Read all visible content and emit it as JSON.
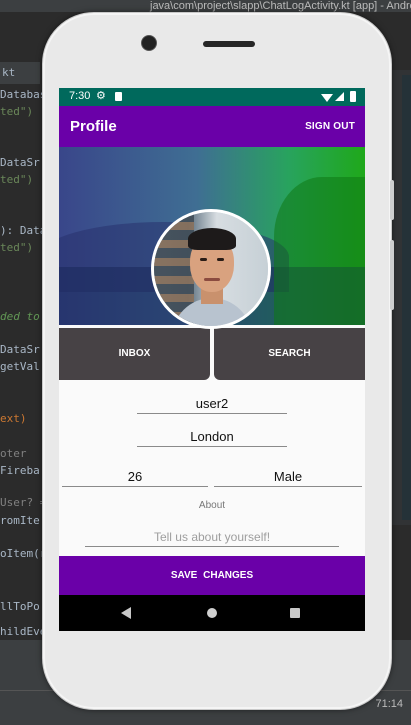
{
  "ide": {
    "title": "java\\com\\project\\slapp\\ChatLogActivity.kt [app] - Android Studio",
    "tab_label": "kt",
    "clock": "71:14",
    "code_lines": [
      {
        "text": "Databas",
        "cls": "c-w"
      },
      {
        "text": "ted\")",
        "cls": "c-s"
      },
      {
        "text": "DataSr",
        "cls": "c-w"
      },
      {
        "text": "ted\")",
        "cls": "c-s"
      },
      {
        "text": "): Data",
        "cls": "c-w"
      },
      {
        "text": "ted\")",
        "cls": "c-s"
      },
      {
        "text": "ded to",
        "cls": "c-c"
      },
      {
        "text": "DataSr",
        "cls": "c-w"
      },
      {
        "text": "getVal",
        "cls": "c-w"
      },
      {
        "text": "ext)",
        "cls": "c-o"
      },
      {
        "text": "oter",
        "cls": "c-g"
      },
      {
        "text": "Fireba",
        "cls": "c-w"
      },
      {
        "text": "User? =",
        "cls": "c-g"
      },
      {
        "text": "romIte",
        "cls": "c-w"
      },
      {
        "text": "oItem(r",
        "cls": "c-w"
      },
      {
        "text": "llToPo",
        "cls": "c-w"
      },
      {
        "text": "hildEve",
        "cls": "c-w"
      }
    ]
  },
  "status_bar": {
    "time": "7:30",
    "gear_icon": "⚙"
  },
  "app_bar": {
    "title": "Profile",
    "action": "SIGN OUT"
  },
  "buttons": {
    "inbox": "INBOX",
    "search": "SEARCH"
  },
  "fields": {
    "username": "user2",
    "location": "London",
    "age": "26",
    "gender": "Male"
  },
  "about": {
    "label": "About",
    "placeholder": "Tell us about yourself!"
  },
  "save_button": "SAVE  CHANGES",
  "colors": {
    "primary": "#6a00a8",
    "status_bar": "#00695c",
    "button_dark": "#474245"
  }
}
